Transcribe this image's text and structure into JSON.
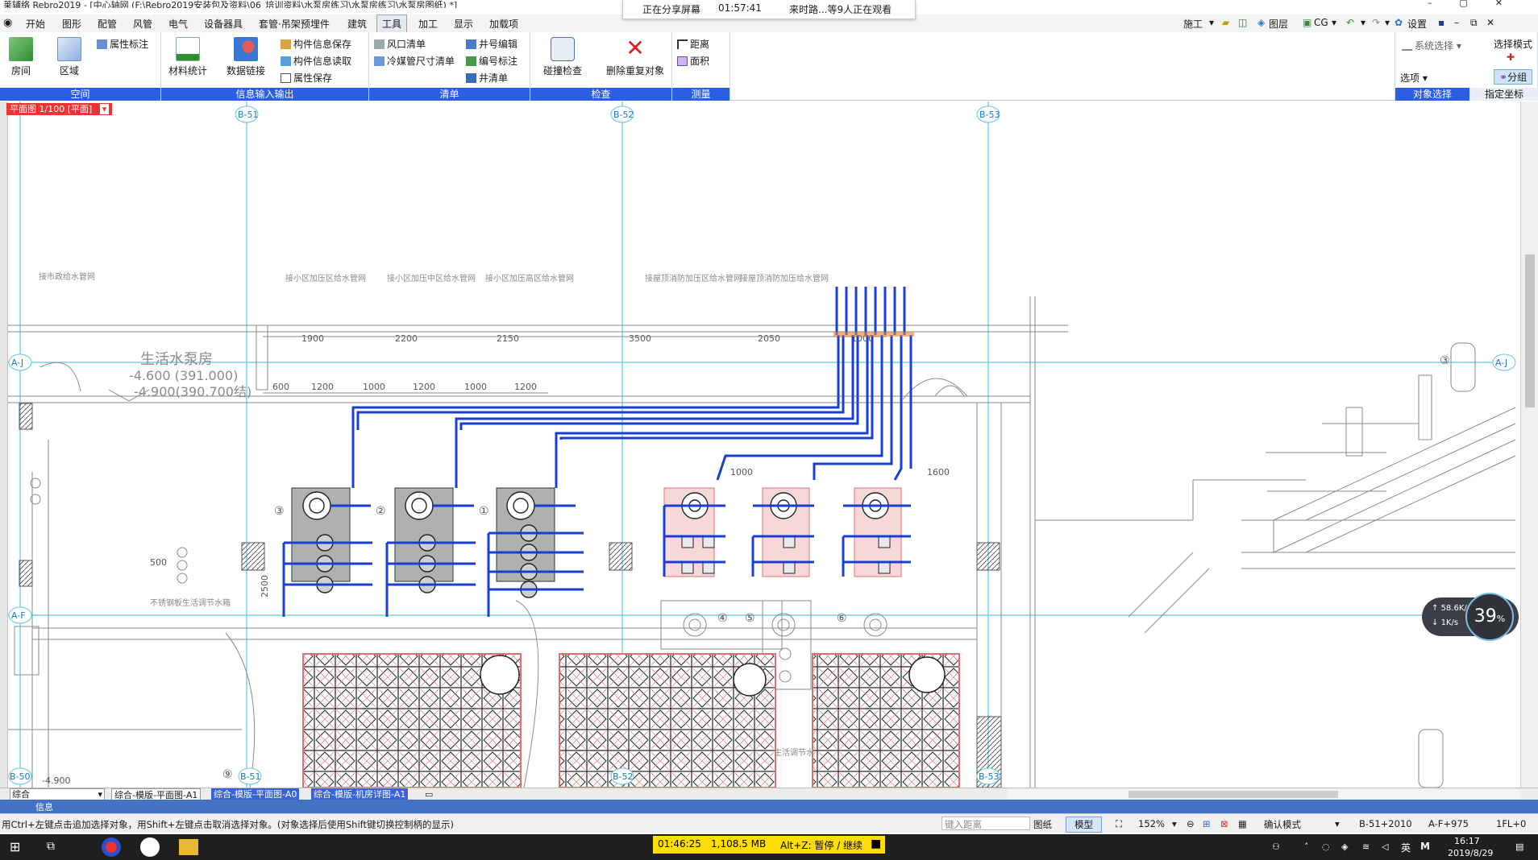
{
  "window": {
    "title": "莱辅络 Rebro2019 - [中心轴网 (F:\\Rebro2019安装包及资料\\06_培训资料\\水泵房练习\\水泵房练习\\水泵房图纸) *]"
  },
  "share_banner": {
    "status": "正在分享屏幕",
    "time": "01:57:41",
    "viewers": "来时路...等9人正在观看"
  },
  "menu": {
    "items": [
      "开始",
      "图形",
      "配管",
      "风管",
      "电气",
      "设备器具",
      "套管·吊架预埋件",
      "建筑",
      "工具",
      "加工",
      "显示",
      "加载项"
    ],
    "active": "工具"
  },
  "quick_toolbar": {
    "construction": "施工",
    "layers": "图层",
    "cg": "CG",
    "settings": "设置"
  },
  "ribbon": {
    "groups": {
      "space": {
        "title": "空间",
        "room": "房间",
        "area": "区域",
        "attr_label": "属性标注"
      },
      "info_io": {
        "title": "信息输入输出",
        "material_stats": "材料统计",
        "data_link": "数据链接",
        "save_info": "构件信息保存",
        "read_info": "构件信息读取",
        "save_attr": "属性保存"
      },
      "list": {
        "title": "清单",
        "vent_list": "风口清单",
        "coil_list": "冷媒管尺寸清单",
        "well_edit": "井号编辑",
        "number_label": "编号标注",
        "well_list": "井清单"
      },
      "check": {
        "title": "检查",
        "collision": "碰撞检查",
        "delete_dup": "删除重复对象"
      },
      "measure": {
        "title": "测量",
        "distance": "距离",
        "area": "面积"
      },
      "select": {
        "system_select": "系统选择",
        "select_mode": "选择模式",
        "options": "选项",
        "group": "分组",
        "object_select": "对象选择",
        "assign_coord": "指定坐标"
      }
    }
  },
  "canvas": {
    "view_tag": "平面图 1/100 [平面]",
    "grid_labels": {
      "b50": "B-50",
      "b51": "B-51",
      "b52": "B-52",
      "b53": "B-53",
      "aj": "A-J",
      "af": "A-F"
    },
    "room_title": "生活水泵房",
    "elev1": "-4.600 (391.000)",
    "elev2": "-4.900(390.700结)",
    "elev_bottom": "-4.900",
    "dims_top": [
      "1900",
      "2200",
      "2150",
      "3500",
      "2050",
      "1000"
    ],
    "dims_pump": [
      "600",
      "1200",
      "1000",
      "1200",
      "1000",
      "1200"
    ],
    "dim_1600": "1600",
    "dim_1000": "1000",
    "dim_500": "500",
    "dim_2500": "2500",
    "pump_numbers": [
      "③",
      "②",
      "①",
      "④",
      "⑤",
      "⑥",
      "⑨"
    ],
    "pipe_notes": [
      "接市政给水管网",
      "接小区加压区给水管网",
      "接小区加压中区给水管网",
      "接小区加压高区给水管网",
      "接屋顶消防加压区给水管网",
      "接屋顶消防加压给水管网"
    ],
    "tank_note": "不锈钢板生活调节水箱",
    "tank_note2": "生活调节水",
    "right_circle": "③"
  },
  "net_gauge": {
    "percent": "39",
    "percent_unit": "%",
    "up": "58.6K/s",
    "down": "1K/s"
  },
  "bottom_tabs": {
    "layer_value": "综合",
    "tabs": [
      "综合-模版-平面图-A1",
      "综合-模版-平面图-A0",
      "综合-模版-机房详图-A1"
    ]
  },
  "info_row": {
    "label": "信息"
  },
  "status": {
    "hint": "用Ctrl+左键点击追加选择对象，用Shift+左键点击取消选择对象。(对象选择后使用Shift键切换控制柄的显示)",
    "input_distance": "键入距离",
    "paper": "图纸",
    "model": "模型",
    "zoom": "152%",
    "confirm_mode": "确认模式",
    "coord_b": "B-51+2010",
    "coord_a": "A-F+975",
    "floor": "1FL+0"
  },
  "taskbar": {
    "rec_time": "01:46:25",
    "rec_mem": "1,108.5 MB",
    "rec_hint": "Alt+Z: 暂停 / 继续",
    "ime": "英",
    "ime2": "M",
    "clock_time": "16:17",
    "clock_date": "2019/8/29"
  },
  "colors": {
    "ribbon_group_title": "#2a5fe0",
    "pipe_blue": "#1a3fd0",
    "grid_cyan": "#5ac8e8",
    "tank_red": "#e06060",
    "rec_yellow": "#ffde00",
    "taskbar": "#1f1f1f"
  }
}
